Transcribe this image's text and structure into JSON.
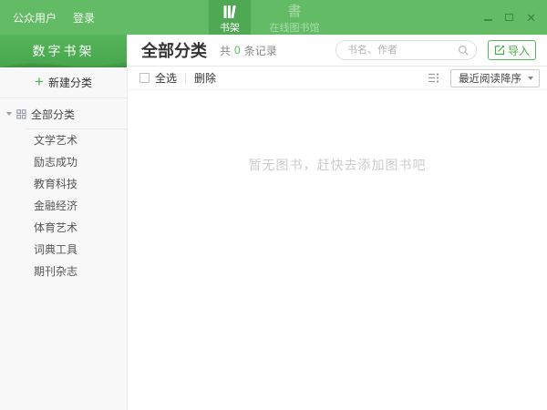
{
  "topbar": {
    "user_label": "公众用户",
    "login_label": "登录",
    "tabs": [
      {
        "id": "bookshelf",
        "label": "书架",
        "active": true
      },
      {
        "id": "online-library",
        "label": "在线图书馆",
        "active": false
      }
    ]
  },
  "sidebar": {
    "title": "数字书架",
    "new_category_label": "新建分类",
    "tree_root": "全部分类",
    "categories": [
      "文学艺术",
      "励志成功",
      "教育科技",
      "金融经济",
      "体育艺术",
      "词典工具",
      "期刊杂志"
    ]
  },
  "main": {
    "title": "全部分类",
    "record_count_prefix": "共",
    "record_count": "0",
    "record_count_suffix": "条记录",
    "search_placeholder": "书名、作者",
    "import_label": "导入",
    "select_all_label": "全选",
    "delete_label": "删除",
    "sort_label": "最近阅读降序",
    "empty_message": "暂无图书，赶快去添加图书吧"
  },
  "icons": {
    "online_library_glyph": "書",
    "plus_glyph": "+",
    "close_glyph": "✕",
    "bookshelf": "three-books",
    "search": "magnifier",
    "import": "compose-box",
    "category_grid": "grid-2x2",
    "list_view": "list-lines-dots",
    "caret": "▾"
  },
  "colors": {
    "topbar_green": "#63bb66",
    "active_tab_green": "#4fa854",
    "banner_green": "#4caf50",
    "accent_green": "#4db151",
    "count_green": "#53b957",
    "sidebar_bg": "#f8f8f8",
    "empty_text": "#cccccc"
  }
}
